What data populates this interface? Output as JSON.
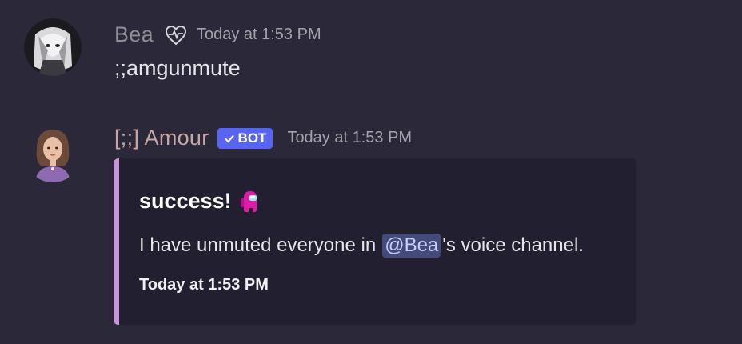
{
  "messages": [
    {
      "username": "Bea",
      "username_color": "#8e8e95",
      "status_icon": "heart-with-pulse-icon",
      "timestamp": "Today at 1:53 PM",
      "content": ";;amgunmute"
    },
    {
      "username": "[;;] Amour",
      "username_color": "#c9a6a6",
      "badge": "BOT",
      "badge_color": "#5865f2",
      "timestamp": "Today at 1:53 PM",
      "embed": {
        "accent_color": "#c796d8",
        "title": "success!",
        "title_icon": "pink-crewmate-icon",
        "description_before": "I have unmuted everyone in",
        "mention": "@Bea",
        "description_after": "'s voice channel.",
        "footer": "Today at 1:53 PM"
      }
    }
  ]
}
